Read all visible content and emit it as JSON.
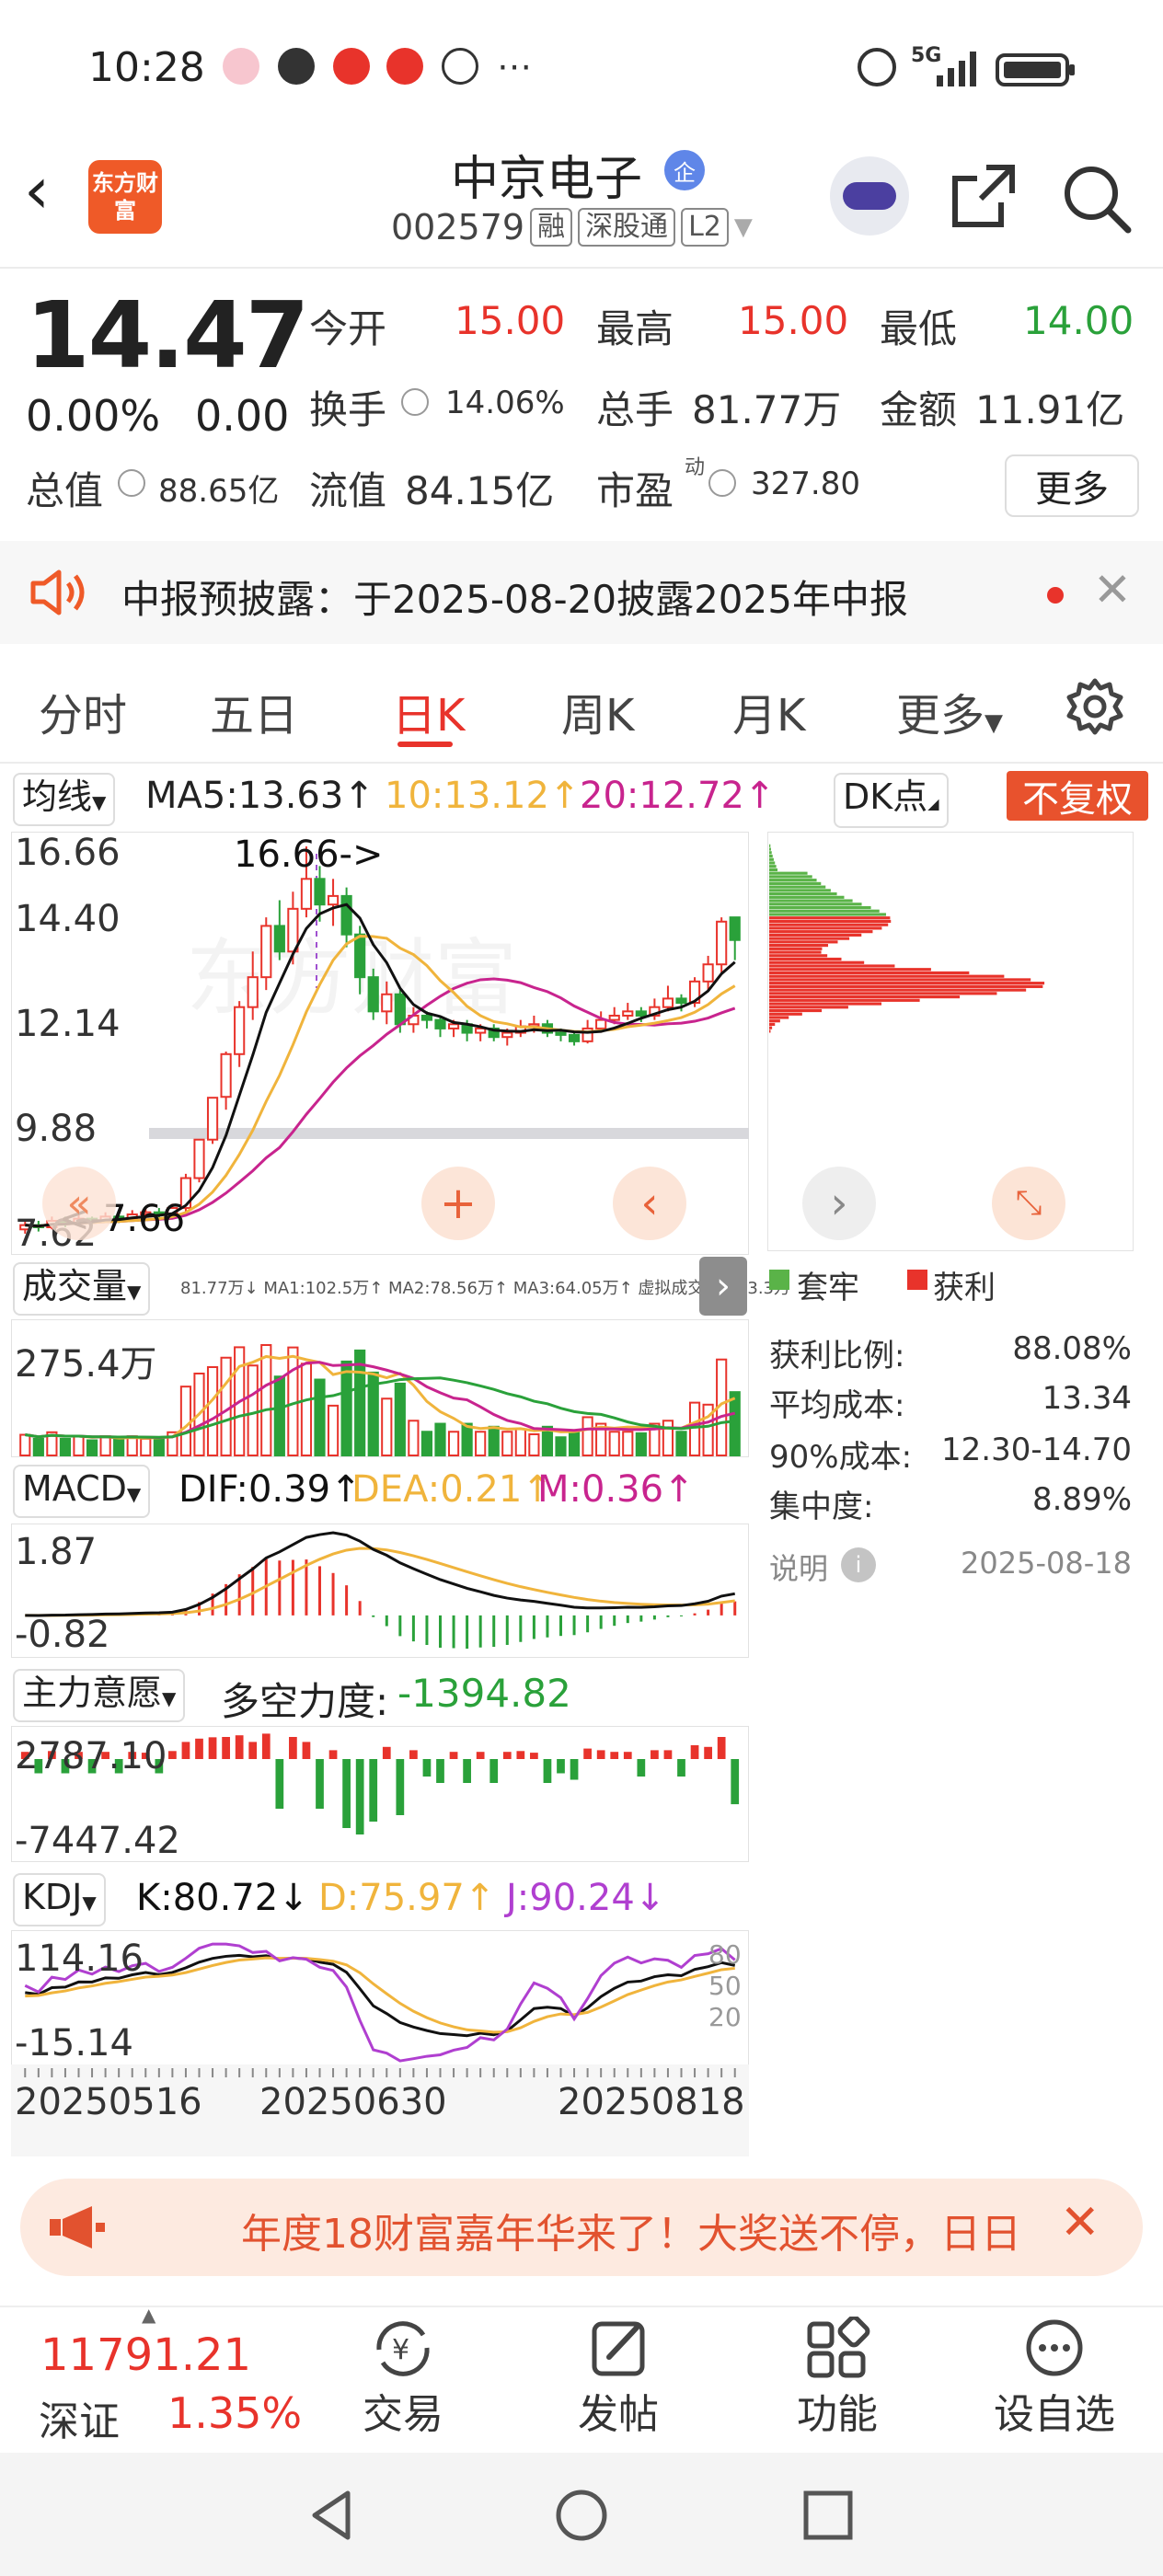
{
  "status": {
    "time": "10:28",
    "network": "5G"
  },
  "header": {
    "logo_text": "东方财富",
    "stock_name": "中京电子",
    "qi_badge": "企",
    "code": "002579",
    "tags": [
      "融",
      "深股通",
      "L2"
    ]
  },
  "quote": {
    "price": "14.47",
    "change_pct": "0.00%",
    "change": "0.00",
    "open_label": "今开",
    "open": "15.00",
    "high_label": "最高",
    "high": "15.00",
    "low_label": "最低",
    "low": "14.00",
    "turnover_label": "换手",
    "turnover": "14.06%",
    "volume_label": "总手",
    "volume": "81.77万",
    "amount_label": "金额",
    "amount": "11.91亿",
    "mktcap_label": "总值",
    "mktcap": "88.65亿",
    "float_label": "流值",
    "float": "84.15亿",
    "pe_label": "市盈",
    "pe_sup": "动",
    "pe": "327.80",
    "more_label": "更多"
  },
  "notice": {
    "text": "中报预披露：于2025-08-20披露2025年中报"
  },
  "tabs": [
    "分时",
    "五日",
    "日K",
    "周K",
    "月K",
    "更多"
  ],
  "active_tab": "日K",
  "chart": {
    "ma_chip": "均线",
    "ma5": "MA5:13.63↑",
    "ma10": "10:13.12↑",
    "ma20": "20:12.72↑",
    "dk_label": "DK点",
    "fq_label": "不复权",
    "price_ticks": [
      "16.66",
      "14.40",
      "12.14",
      "9.88",
      "7.62"
    ],
    "high_mark": "16.66->",
    "low_mark": "<-7.66",
    "volume_chip": "成交量",
    "volume_small": "81.77万↓ MA1:102.5万↑ MA2:78.56万↑ MA3:64.05万↑ 虚拟成交量:163.3万",
    "volume_tick": "275.4万",
    "macd_chip": "MACD",
    "dif": "DIF:0.39↑",
    "dea": "DEA:0.21↑",
    "m": "M:0.36↑",
    "macd_ticks": [
      "1.87",
      "-0.82"
    ],
    "zl_chip": "主力意愿",
    "duokong": "多空力度:",
    "duokong_val": "-1394.82",
    "zl_ticks": [
      "2787.10",
      "-7447.42"
    ],
    "kdj_chip": "KDJ",
    "k": "K:80.72↓",
    "d": "D:75.97↑",
    "j": "J:90.24↓",
    "kdj_ticks": [
      "114.16",
      "-15.14"
    ],
    "kdj_levels": [
      "80",
      "50",
      "20"
    ],
    "dates": [
      "20250516",
      "20250630",
      "20250818"
    ]
  },
  "chip_dist": {
    "legend_trapped": "套牢",
    "legend_profit": "获利",
    "rows": [
      {
        "label": "获利比例:",
        "value": "88.08%"
      },
      {
        "label": "平均成本:",
        "value": "13.34"
      },
      {
        "label": "90%成本:",
        "value": "12.30-14.70"
      },
      {
        "label": "集中度:",
        "value": "8.89%"
      }
    ],
    "note_label": "说明",
    "date": "2025-08-18"
  },
  "ad": {
    "text": "年度18财富嘉年华来了！大奖送不停，日日"
  },
  "bottom": {
    "index_value": "11791.21",
    "index_name": "深证",
    "index_change": "1.35%",
    "items": [
      "交易",
      "发帖",
      "功能",
      "设自选"
    ]
  },
  "colors": {
    "red": "#e8332b",
    "green": "#2aa13a",
    "orange": "#f0b43c",
    "magenta": "#c8248e",
    "purple": "#b03fd0"
  },
  "chart_data": {
    "type": "candlestick",
    "ylim": [
      7.62,
      16.66
    ],
    "candles": [
      {
        "o": 7.7,
        "c": 7.8,
        "h": 7.9,
        "l": 7.6
      },
      {
        "o": 7.8,
        "c": 7.75,
        "h": 7.9,
        "l": 7.65
      },
      {
        "o": 7.75,
        "c": 7.9,
        "h": 8.0,
        "l": 7.7
      },
      {
        "o": 7.9,
        "c": 7.85,
        "h": 8.0,
        "l": 7.75
      },
      {
        "o": 7.85,
        "c": 7.95,
        "h": 8.05,
        "l": 7.8
      },
      {
        "o": 7.95,
        "c": 7.9,
        "h": 8.0,
        "l": 7.8
      },
      {
        "o": 7.9,
        "c": 8.0,
        "h": 8.1,
        "l": 7.85
      },
      {
        "o": 8.0,
        "c": 7.95,
        "h": 8.1,
        "l": 7.85
      },
      {
        "o": 7.95,
        "c": 8.05,
        "h": 8.15,
        "l": 7.9
      },
      {
        "o": 8.05,
        "c": 8.1,
        "h": 8.2,
        "l": 7.95
      },
      {
        "o": 8.1,
        "c": 8.05,
        "h": 8.2,
        "l": 7.95
      },
      {
        "o": 8.05,
        "c": 8.2,
        "h": 8.3,
        "l": 8.0
      },
      {
        "o": 8.2,
        "c": 8.9,
        "h": 9.0,
        "l": 8.1
      },
      {
        "o": 8.9,
        "c": 9.8,
        "h": 9.8,
        "l": 8.8
      },
      {
        "o": 9.8,
        "c": 10.78,
        "h": 10.78,
        "l": 9.7
      },
      {
        "o": 10.8,
        "c": 11.8,
        "h": 11.86,
        "l": 10.5
      },
      {
        "o": 11.8,
        "c": 12.9,
        "h": 13.04,
        "l": 11.5
      },
      {
        "o": 12.9,
        "c": 13.6,
        "h": 14.2,
        "l": 12.6
      },
      {
        "o": 13.6,
        "c": 14.8,
        "h": 15.0,
        "l": 13.3
      },
      {
        "o": 14.8,
        "c": 14.2,
        "h": 15.4,
        "l": 14.0
      },
      {
        "o": 14.2,
        "c": 15.2,
        "h": 15.6,
        "l": 13.9
      },
      {
        "o": 15.2,
        "c": 15.9,
        "h": 16.66,
        "l": 15.0
      },
      {
        "o": 15.9,
        "c": 15.3,
        "h": 16.2,
        "l": 14.9
      },
      {
        "o": 15.3,
        "c": 15.5,
        "h": 15.9,
        "l": 14.8
      },
      {
        "o": 15.5,
        "c": 14.6,
        "h": 15.7,
        "l": 14.3
      },
      {
        "o": 14.6,
        "c": 13.6,
        "h": 14.8,
        "l": 13.2
      },
      {
        "o": 13.6,
        "c": 12.8,
        "h": 13.8,
        "l": 12.6
      },
      {
        "o": 12.8,
        "c": 13.2,
        "h": 13.5,
        "l": 12.5
      },
      {
        "o": 13.2,
        "c": 12.5,
        "h": 13.3,
        "l": 12.3
      },
      {
        "o": 12.5,
        "c": 12.7,
        "h": 12.9,
        "l": 12.3
      },
      {
        "o": 12.7,
        "c": 12.6,
        "h": 12.8,
        "l": 12.4
      },
      {
        "o": 12.6,
        "c": 12.4,
        "h": 12.7,
        "l": 12.2
      },
      {
        "o": 12.4,
        "c": 12.5,
        "h": 12.6,
        "l": 12.2
      },
      {
        "o": 12.5,
        "c": 12.3,
        "h": 12.6,
        "l": 12.1
      },
      {
        "o": 12.3,
        "c": 12.4,
        "h": 12.5,
        "l": 12.1
      },
      {
        "o": 12.4,
        "c": 12.2,
        "h": 12.5,
        "l": 12.1
      },
      {
        "o": 12.2,
        "c": 12.3,
        "h": 12.4,
        "l": 12.0
      },
      {
        "o": 12.3,
        "c": 12.45,
        "h": 12.6,
        "l": 12.2
      },
      {
        "o": 12.45,
        "c": 12.5,
        "h": 12.7,
        "l": 12.3
      },
      {
        "o": 12.5,
        "c": 12.3,
        "h": 12.6,
        "l": 12.2
      },
      {
        "o": 12.3,
        "c": 12.25,
        "h": 12.4,
        "l": 12.1
      },
      {
        "o": 12.25,
        "c": 12.1,
        "h": 12.35,
        "l": 12.0
      },
      {
        "o": 12.1,
        "c": 12.4,
        "h": 12.6,
        "l": 12.05
      },
      {
        "o": 12.4,
        "c": 12.6,
        "h": 12.8,
        "l": 12.3
      },
      {
        "o": 12.6,
        "c": 12.7,
        "h": 12.9,
        "l": 12.5
      },
      {
        "o": 12.7,
        "c": 12.8,
        "h": 13.0,
        "l": 12.6
      },
      {
        "o": 12.8,
        "c": 12.7,
        "h": 12.9,
        "l": 12.55
      },
      {
        "o": 12.7,
        "c": 12.9,
        "h": 13.1,
        "l": 12.6
      },
      {
        "o": 12.9,
        "c": 13.1,
        "h": 13.4,
        "l": 12.8
      },
      {
        "o": 13.1,
        "c": 13.0,
        "h": 13.2,
        "l": 12.8
      },
      {
        "o": 13.0,
        "c": 13.5,
        "h": 13.6,
        "l": 12.9
      },
      {
        "o": 13.5,
        "c": 13.9,
        "h": 14.1,
        "l": 13.3
      },
      {
        "o": 13.9,
        "c": 14.9,
        "h": 15.0,
        "l": 13.7
      },
      {
        "o": 15.0,
        "c": 14.47,
        "h": 15.0,
        "l": 14.0
      }
    ]
  }
}
